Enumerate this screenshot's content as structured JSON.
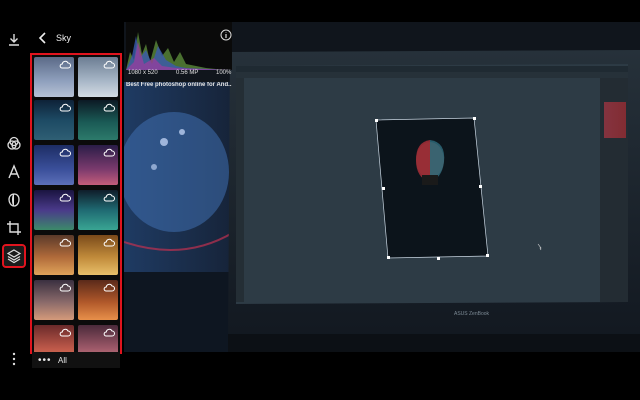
{
  "panel": {
    "title": "Sky",
    "more_label": "All"
  },
  "image_info": {
    "dimensions": "1080 x 520",
    "megapixels": "0.56 MP",
    "zoom": "100%",
    "description": "Best Free photoshop online for And..."
  },
  "laptop_brand": "ASUS ZenBook",
  "toolbar": {
    "items": [
      "adjust-icon",
      "text-icon",
      "mask-icon",
      "crop-icon",
      "layers-icon"
    ],
    "active": "layers-icon"
  },
  "colors": {
    "accent": "#e0141e",
    "panel_bg": "#0b0b0b",
    "canvas_bg": "#3b4a55"
  },
  "sky_presets_count": 14
}
